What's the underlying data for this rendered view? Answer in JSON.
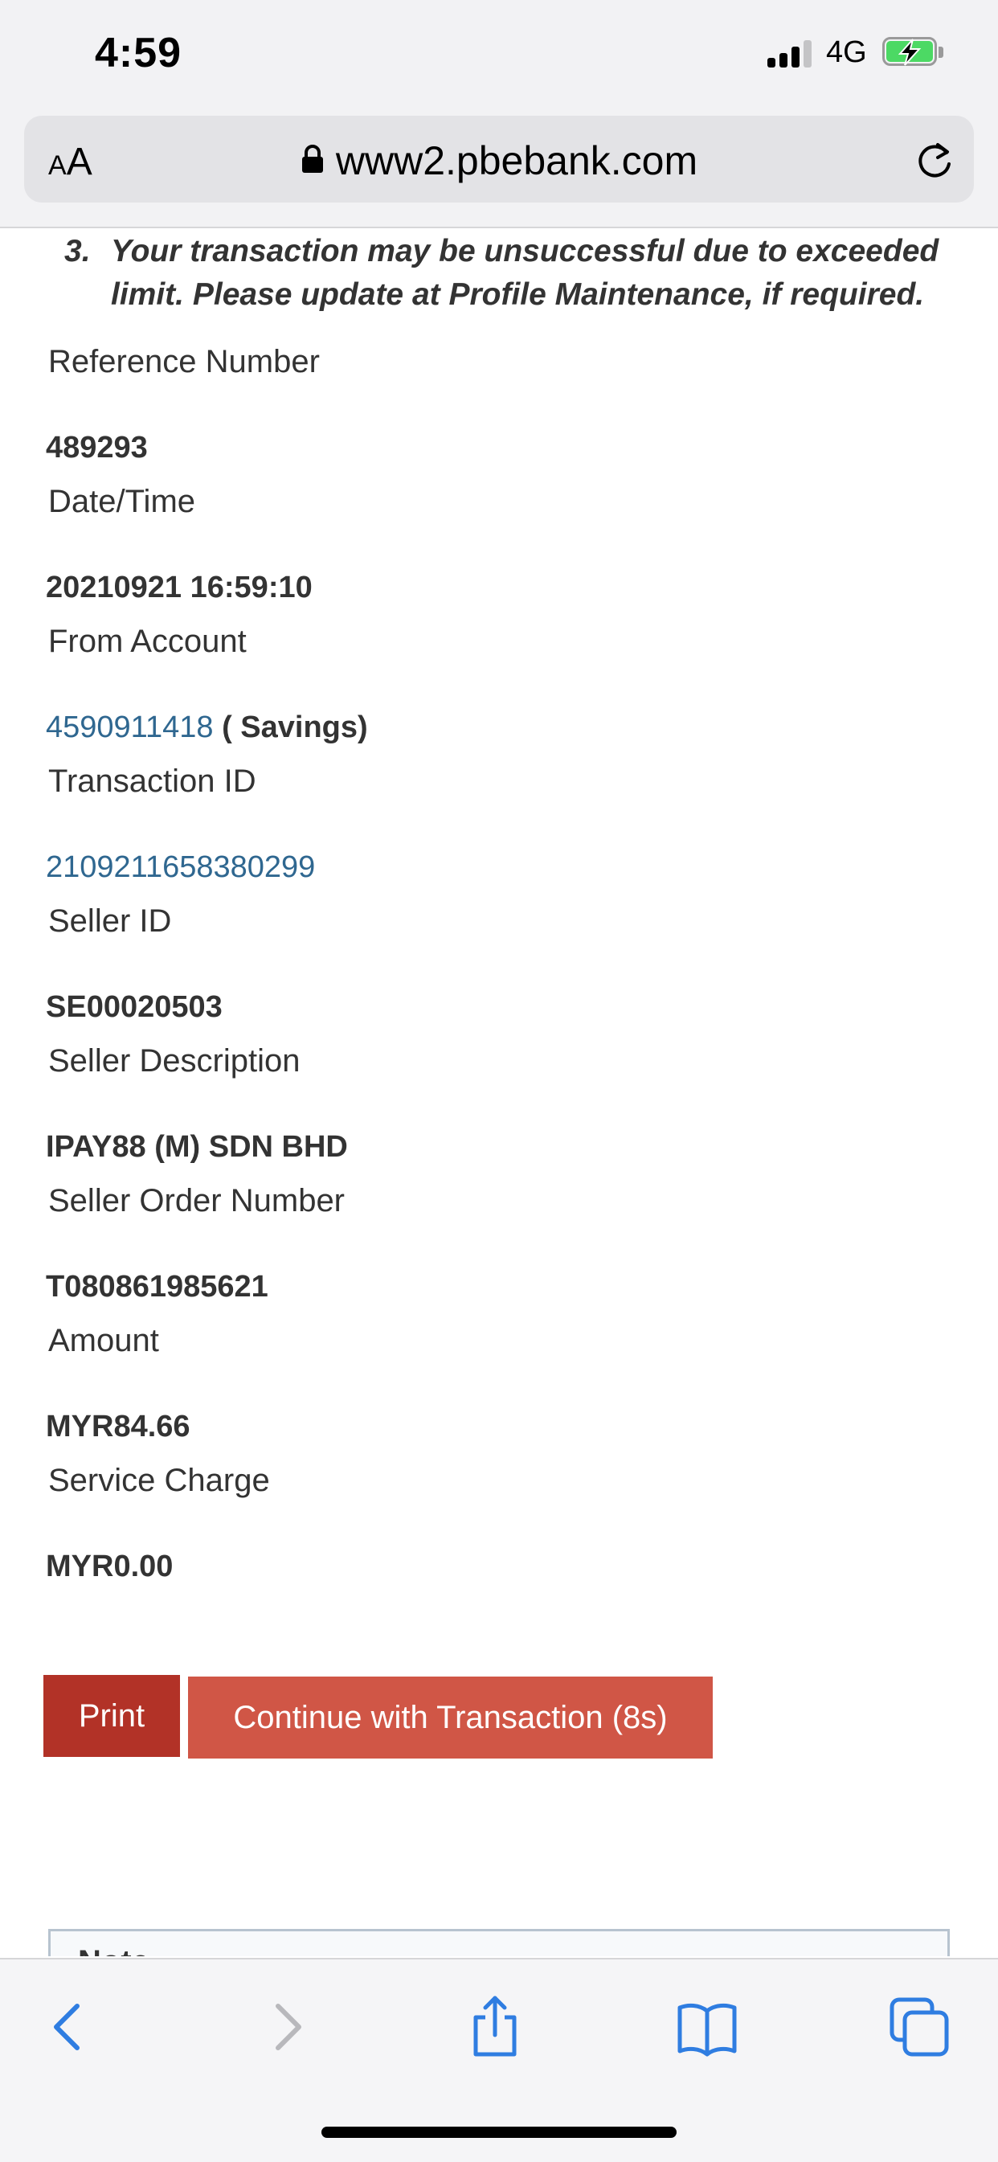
{
  "status_bar": {
    "time": "4:59",
    "network": "4G",
    "battery_state": "charging",
    "accent_battery": "#4cd964"
  },
  "browser": {
    "text_size_label_small": "A",
    "text_size_label_large": "A",
    "url": "www2.pbebank.com",
    "icons": [
      "lock-icon",
      "reload-icon"
    ]
  },
  "notice": {
    "number": "3.",
    "text": "Your transaction may be unsuccessful due to exceeded limit. Please update at Profile Maintenance, if required."
  },
  "fields": {
    "reference_number": {
      "label": "Reference Number",
      "value": "489293"
    },
    "date_time": {
      "label": "Date/Time",
      "value": "20210921 16:59:10"
    },
    "from_account": {
      "label": "From Account",
      "account": "4590911418",
      "type": " ( Savings)"
    },
    "transaction_id": {
      "label": "Transaction ID",
      "value": "2109211658380299"
    },
    "seller_id": {
      "label": "Seller ID",
      "value": "SE00020503"
    },
    "seller_description": {
      "label": "Seller Description",
      "value": "IPAY88 (M) SDN BHD"
    },
    "seller_order_number": {
      "label": "Seller Order Number",
      "value": "T080861985621"
    },
    "amount": {
      "label": "Amount",
      "value": "MYR84.66"
    },
    "service_charge": {
      "label": "Service Charge",
      "value": "MYR0.00"
    }
  },
  "buttons": {
    "print": "Print",
    "continue": "Continue with Transaction (8s)"
  },
  "note": {
    "title": "Note"
  },
  "colors": {
    "print_button": "#b23227",
    "continue_button": "#d05646",
    "link": "#2f6790",
    "ios_blue": "#2f7de1"
  },
  "toolbar": {
    "icons": [
      "back-icon",
      "forward-icon",
      "share-icon",
      "bookmarks-icon",
      "tabs-icon"
    ]
  }
}
